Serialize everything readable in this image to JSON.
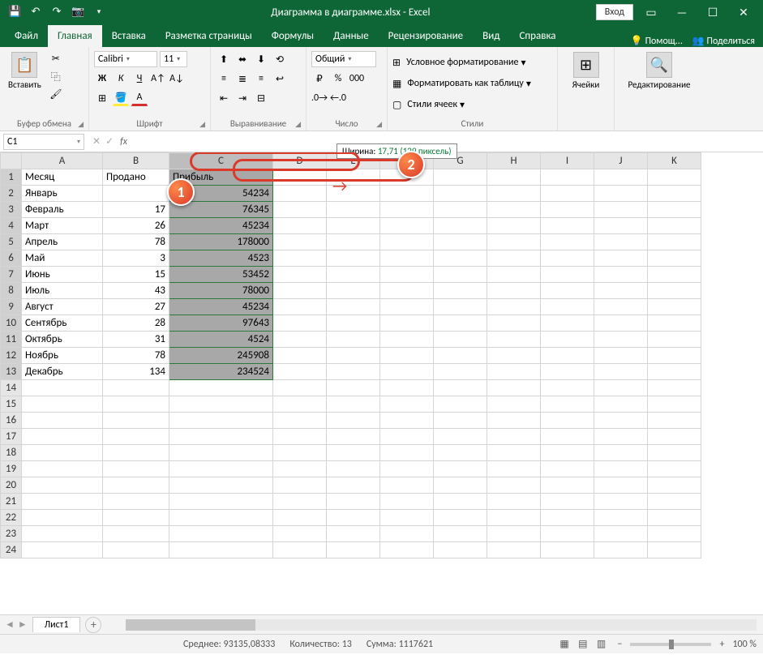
{
  "title": "Диаграмма в диаграмме.xlsx - Excel",
  "login": "Вход",
  "tabs": [
    "Файл",
    "Главная",
    "Вставка",
    "Разметка страницы",
    "Формулы",
    "Данные",
    "Рецензирование",
    "Вид",
    "Справка"
  ],
  "active_tab": "Главная",
  "help_hint": "Помощ...",
  "share": "Поделиться",
  "ribbon": {
    "paste": "Вставить",
    "clipboard": "Буфер обмена",
    "font_name": "Calibri",
    "font_size": "11",
    "font_group": "Шрифт",
    "align_group": "Выравнивание",
    "number_format": "Общий",
    "number_group": "Число",
    "cond_format": "Условное форматирование",
    "format_table": "Форматировать как таблицу",
    "cell_styles": "Стили ячеек",
    "styles_group": "Стили",
    "cells": "Ячейки",
    "editing": "Редактирование"
  },
  "namebox": "C1",
  "width_tip_label": "Ширина:",
  "width_tip_value": "17,71 (129 пиксель)",
  "columns": [
    "A",
    "B",
    "C",
    "D",
    "E",
    "F",
    "G",
    "H",
    "I",
    "J",
    "K"
  ],
  "headers": {
    "A": "Месяц",
    "B": "Продано",
    "C": "Прибыль"
  },
  "rows": [
    {
      "r": 1,
      "A": "Месяц",
      "B": "Продано",
      "C": "Прибыль"
    },
    {
      "r": 2,
      "A": "Январь",
      "B": "",
      "C": "54234"
    },
    {
      "r": 3,
      "A": "Февраль",
      "B": "17",
      "C": "76345"
    },
    {
      "r": 4,
      "A": "Март",
      "B": "26",
      "C": "45234"
    },
    {
      "r": 5,
      "A": "Апрель",
      "B": "78",
      "C": "178000"
    },
    {
      "r": 6,
      "A": "Май",
      "B": "3",
      "C": "4523"
    },
    {
      "r": 7,
      "A": "Июнь",
      "B": "15",
      "C": "53452"
    },
    {
      "r": 8,
      "A": "Июль",
      "B": "43",
      "C": "78000"
    },
    {
      "r": 9,
      "A": "Август",
      "B": "27",
      "C": "45234"
    },
    {
      "r": 10,
      "A": "Сентябрь",
      "B": "28",
      "C": "97643"
    },
    {
      "r": 11,
      "A": "Октябрь",
      "B": "31",
      "C": "4524"
    },
    {
      "r": 12,
      "A": "Ноябрь",
      "B": "78",
      "C": "245908"
    },
    {
      "r": 13,
      "A": "Декабрь",
      "B": "134",
      "C": "234524"
    }
  ],
  "sheet": "Лист1",
  "status": {
    "avg_label": "Среднее:",
    "avg": "93135,08333",
    "count_label": "Количество:",
    "count": "13",
    "sum_label": "Сумма:",
    "sum": "1117621",
    "zoom": "100 %"
  },
  "badges": {
    "b1": "1",
    "b2": "2"
  }
}
